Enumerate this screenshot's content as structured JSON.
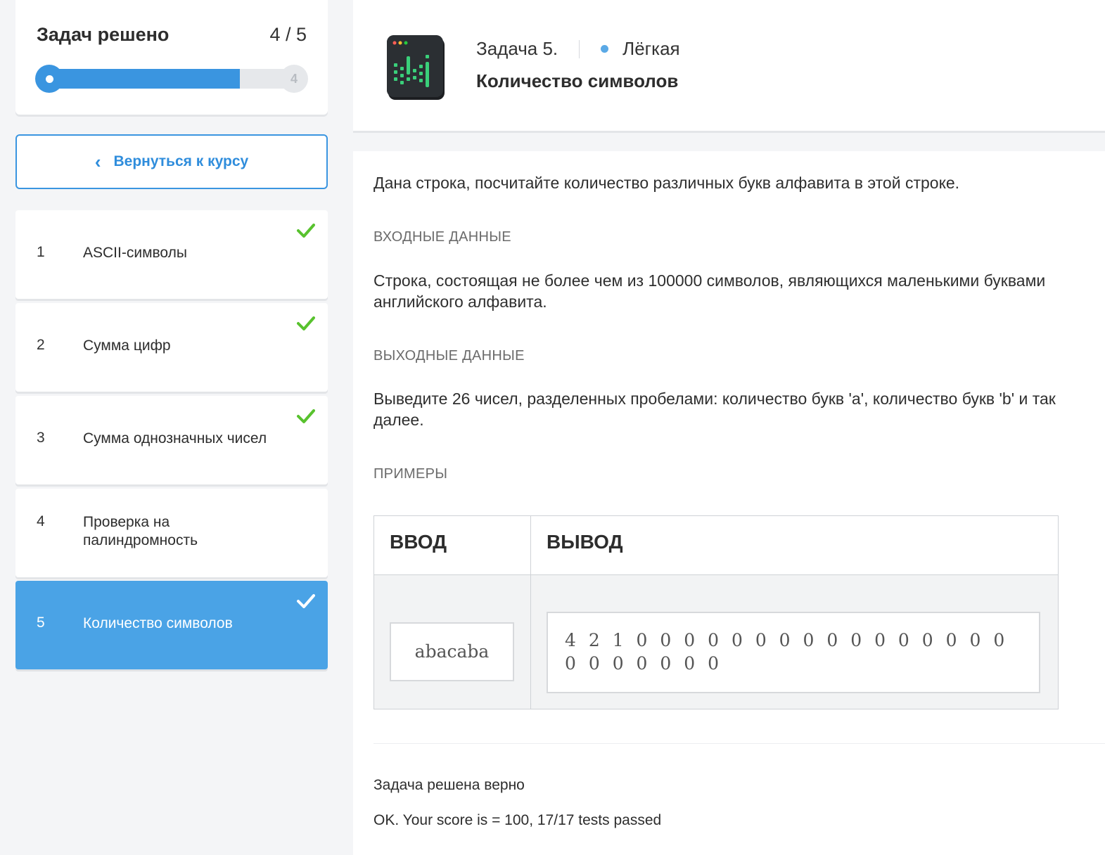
{
  "progress": {
    "title": "Задач решено",
    "count_label": "4 / 5",
    "solved": 4,
    "total": 5,
    "end_marker": "4"
  },
  "back_button": {
    "label": "Вернуться к курсу"
  },
  "tasks": [
    {
      "num": "1",
      "label": "ASCII-символы",
      "done": true
    },
    {
      "num": "2",
      "label": "Сумма цифр",
      "done": true
    },
    {
      "num": "3",
      "label": "Сумма однозначных чисел",
      "done": true
    },
    {
      "num": "4",
      "label": "Проверка на палиндромность",
      "done": false
    },
    {
      "num": "5",
      "label": "Количество символов",
      "done": true,
      "active": true
    }
  ],
  "header": {
    "task_number": "Задача 5.",
    "difficulty": "Лёгкая",
    "title": "Количество символов"
  },
  "statement": {
    "description": "Дана строка, посчитайте количество различных букв алфавита в этой строке.",
    "input_heading": "ВХОДНЫЕ ДАННЫЕ",
    "input_text": "Строка, состоящая не более чем из 100000 символов, являющихся маленькими буквами английского алфавита.",
    "output_heading": "ВЫХОДНЫЕ ДАННЫЕ",
    "output_text": "Выведите 26 чисел, разделенных пробелами: количество букв 'a', количество букв 'b' и так далее.",
    "examples_heading": "ПРИМЕРЫ"
  },
  "examples": {
    "input_header": "ВВОД",
    "output_header": "ВЫВОД",
    "input_value": "abacaba",
    "output_value": "4 2 1 0 0 0 0 0 0 0 0 0 0 0 0 0 0 0 0 0 0 0 0 0 0 0"
  },
  "result": {
    "status": "Задача решена верно",
    "details": "OK. Your score is = 100, 17/17 tests passed"
  },
  "colors": {
    "accent": "#3a95e0",
    "active_item": "#4aa3e6",
    "check": "#58c22e",
    "difficulty_dot": "#5aa9e6"
  }
}
